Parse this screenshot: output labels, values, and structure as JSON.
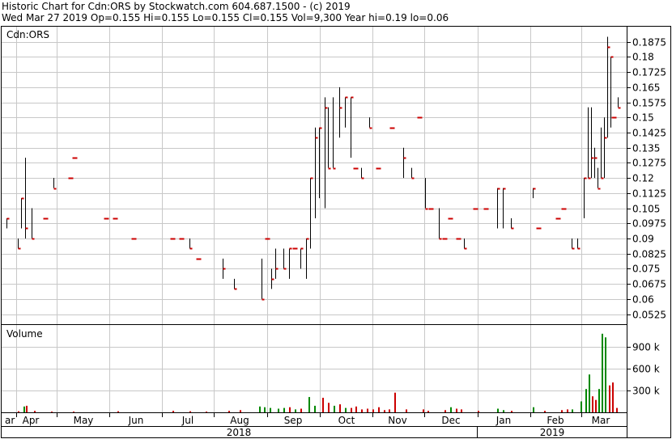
{
  "header": {
    "line1": "Historic Chart for Cdn:ORS by Stockwatch.com 604.687.1500 - (c) 2019",
    "line2": "Wed Mar 27 2019   Op=0.155  Hi=0.155  Lo=0.155  Cl=0.155  Vol=9,300   Year hi=0.19  lo=0.06"
  },
  "colors": {
    "up": "#000000",
    "down": "#cc0000",
    "vol_up": "#008800",
    "vol_down": "#cc0000",
    "grid": "#c8c8c8"
  },
  "chart_data": [
    {
      "type": "ohlc",
      "title": "Cdn:ORS",
      "ylim": [
        0.0475,
        0.195
      ],
      "y_ticks": [
        0.0525,
        0.06,
        0.0675,
        0.075,
        0.0825,
        0.09,
        0.0975,
        0.105,
        0.1125,
        0.12,
        0.1275,
        0.135,
        0.1425,
        0.15,
        0.1575,
        0.165,
        0.1725,
        0.18,
        0.1875
      ],
      "y_tick_labels": [
        "0.0525",
        "0.06",
        "0.0675",
        "0.075",
        "0.0825",
        "0.09",
        "0.0975",
        "0.105",
        "0.1125",
        "0.12",
        "0.1275",
        "0.135",
        "0.1425",
        "0.15",
        "0.1575",
        "0.165",
        "0.1725",
        "0.18",
        "0.1875"
      ],
      "x_labels": [
        "ar",
        "Apr",
        "May",
        "Jun",
        "Jul",
        "Aug",
        "Sep",
        "Oct",
        "Nov",
        "Dec",
        "Jan",
        "Feb",
        "Mar"
      ],
      "year_labels": [
        "2018",
        "2019"
      ],
      "grid": true,
      "bars": [
        [
          0,
          0.095,
          0.1,
          0.095,
          0.1,
          "u"
        ],
        [
          2.1,
          0.09,
          0.09,
          0.085,
          0.085,
          "d"
        ],
        [
          2.7,
          0.105,
          0.11,
          0.095,
          0.11,
          "u"
        ],
        [
          3.4,
          0.095,
          0.13,
          0.09,
          0.095,
          "d"
        ],
        [
          4.5,
          0.095,
          0.105,
          0.09,
          0.09,
          "d"
        ],
        [
          7,
          0.1,
          0.1,
          0.1,
          0.1,
          "d"
        ],
        [
          8.5,
          0.115,
          0.12,
          0.115,
          0.115,
          "d"
        ],
        [
          11.5,
          0.12,
          0.12,
          0.12,
          0.12,
          "d"
        ],
        [
          12.3,
          0.13,
          0.13,
          0.13,
          0.13,
          "d"
        ],
        [
          18,
          0.1,
          0.1,
          0.1,
          0.1,
          "d"
        ],
        [
          19.5,
          0.1,
          0.1,
          0.1,
          0.1,
          "d"
        ],
        [
          23,
          0.09,
          0.09,
          0.09,
          0.09,
          "d"
        ],
        [
          30,
          0.09,
          0.09,
          0.09,
          0.09,
          "d"
        ],
        [
          31.5,
          0.09,
          0.09,
          0.09,
          0.09,
          "d"
        ],
        [
          33,
          0.085,
          0.09,
          0.085,
          0.085,
          "d"
        ],
        [
          34.6,
          0.08,
          0.08,
          0.08,
          0.08,
          "d"
        ],
        [
          39,
          0.075,
          0.08,
          0.07,
          0.075,
          "d"
        ],
        [
          41,
          0.065,
          0.07,
          0.065,
          0.065,
          "d"
        ],
        [
          46,
          0.06,
          0.08,
          0.06,
          0.06,
          "d"
        ],
        [
          47,
          0.09,
          0.09,
          0.09,
          0.09,
          "d"
        ],
        [
          47.7,
          0.07,
          0.075,
          0.065,
          0.07,
          "u"
        ],
        [
          48.5,
          0.075,
          0.085,
          0.07,
          0.075,
          "d"
        ],
        [
          50,
          0.075,
          0.085,
          0.075,
          0.075,
          "d"
        ],
        [
          51,
          0.085,
          0.085,
          0.07,
          0.085,
          "u"
        ],
        [
          52,
          0.085,
          0.085,
          0.085,
          0.085,
          "d"
        ],
        [
          53,
          0.075,
          0.085,
          0.075,
          0.085,
          "u"
        ],
        [
          54,
          0.085,
          0.09,
          0.07,
          0.09,
          "u"
        ],
        [
          54.7,
          0.115,
          0.12,
          0.085,
          0.12,
          "u"
        ],
        [
          55.6,
          0.135,
          0.145,
          0.1,
          0.14,
          "u"
        ],
        [
          56.4,
          0.14,
          0.145,
          0.11,
          0.145,
          "u"
        ],
        [
          57.4,
          0.115,
          0.16,
          0.105,
          0.155,
          "u"
        ],
        [
          58,
          0.155,
          0.155,
          0.125,
          0.125,
          "d"
        ],
        [
          58.8,
          0.125,
          0.16,
          0.125,
          0.125,
          "d"
        ],
        [
          60,
          0.14,
          0.165,
          0.14,
          0.155,
          "d"
        ],
        [
          61,
          0.16,
          0.16,
          0.145,
          0.16,
          "d"
        ],
        [
          62,
          0.16,
          0.16,
          0.13,
          0.16,
          "d"
        ],
        [
          63,
          0.125,
          0.125,
          0.125,
          0.125,
          "d"
        ],
        [
          64,
          0.125,
          0.125,
          0.12,
          0.12,
          "d"
        ],
        [
          65.5,
          0.145,
          0.15,
          0.145,
          0.145,
          "d"
        ],
        [
          67,
          0.125,
          0.125,
          0.125,
          0.125,
          "d"
        ],
        [
          69.5,
          0.145,
          0.145,
          0.145,
          0.145,
          "d"
        ],
        [
          71.5,
          0.135,
          0.135,
          0.12,
          0.13,
          "d"
        ],
        [
          73,
          0.125,
          0.125,
          0.12,
          0.12,
          "d"
        ],
        [
          74.5,
          0.15,
          0.15,
          0.15,
          0.15,
          "d"
        ],
        [
          75.5,
          0.115,
          0.12,
          0.105,
          0.105,
          "d"
        ],
        [
          76.5,
          0.105,
          0.105,
          0.105,
          0.105,
          "d"
        ],
        [
          78,
          0.105,
          0.105,
          0.09,
          0.09,
          "d"
        ],
        [
          79,
          0.09,
          0.09,
          0.09,
          0.09,
          "d"
        ],
        [
          80,
          0.1,
          0.1,
          0.1,
          0.1,
          "d"
        ],
        [
          81.5,
          0.09,
          0.09,
          0.09,
          0.09,
          "d"
        ],
        [
          82.5,
          0.09,
          0.09,
          0.085,
          0.085,
          "d"
        ],
        [
          84.5,
          0.105,
          0.105,
          0.105,
          0.105,
          "d"
        ],
        [
          86.5,
          0.105,
          0.105,
          0.105,
          0.105,
          "d"
        ],
        [
          88.5,
          0.115,
          0.115,
          0.095,
          0.115,
          "u"
        ],
        [
          89.5,
          0.115,
          0.115,
          0.095,
          0.115,
          "u"
        ],
        [
          91,
          0.1,
          0.1,
          0.095,
          0.095,
          "d"
        ],
        [
          95,
          0.115,
          0.115,
          0.11,
          0.115,
          "u"
        ],
        [
          96,
          0.095,
          0.095,
          0.095,
          0.095,
          "d"
        ],
        [
          99.5,
          0.1,
          0.1,
          0.1,
          0.1,
          "d"
        ],
        [
          100.5,
          0.105,
          0.105,
          0.105,
          0.105,
          "d"
        ],
        [
          102,
          0.09,
          0.09,
          0.085,
          0.085,
          "d"
        ],
        [
          103,
          0.085,
          0.09,
          0.085,
          0.085,
          "d"
        ],
        [
          104.2,
          0.1,
          0.12,
          0.1,
          0.12,
          "u"
        ],
        [
          104.8,
          0.12,
          0.155,
          0.12,
          0.12,
          "d"
        ],
        [
          105.4,
          0.125,
          0.155,
          0.12,
          0.13,
          "u"
        ],
        [
          106,
          0.13,
          0.135,
          0.12,
          0.13,
          "d"
        ],
        [
          106.6,
          0.12,
          0.125,
          0.115,
          0.115,
          "d"
        ],
        [
          107.2,
          0.125,
          0.145,
          0.12,
          0.12,
          "d"
        ],
        [
          107.8,
          0.12,
          0.15,
          0.12,
          0.14,
          "u"
        ],
        [
          108.4,
          0.14,
          0.19,
          0.14,
          0.185,
          "u"
        ],
        [
          109,
          0.18,
          0.18,
          0.145,
          0.18,
          "u"
        ],
        [
          109.6,
          0.15,
          0.15,
          0.15,
          0.15,
          "d"
        ],
        [
          110.2,
          0.155,
          0.16,
          0.155,
          0.155,
          "d"
        ]
      ]
    },
    {
      "type": "bar",
      "title": "Volume",
      "ylim": [
        0,
        1200000
      ],
      "y_ticks": [
        300000,
        600000,
        900000
      ],
      "y_tick_labels": [
        "300 k",
        "600 k",
        "900 k"
      ],
      "bars": [
        [
          2,
          15000,
          "d"
        ],
        [
          3,
          80000,
          "g"
        ],
        [
          3.5,
          90000,
          "d"
        ],
        [
          5,
          20000,
          "d"
        ],
        [
          8,
          10000,
          "d"
        ],
        [
          12,
          10000,
          "d"
        ],
        [
          20,
          15000,
          "d"
        ],
        [
          30,
          20000,
          "d"
        ],
        [
          33,
          15000,
          "d"
        ],
        [
          36,
          10000,
          "d"
        ],
        [
          40,
          20000,
          "d"
        ],
        [
          42,
          30000,
          "d"
        ],
        [
          45.5,
          80000,
          "g"
        ],
        [
          46.5,
          70000,
          "g"
        ],
        [
          47.5,
          60000,
          "g"
        ],
        [
          49,
          50000,
          "g"
        ],
        [
          50,
          60000,
          "g"
        ],
        [
          51,
          70000,
          "d"
        ],
        [
          52,
          40000,
          "g"
        ],
        [
          53,
          50000,
          "d"
        ],
        [
          54.5,
          210000,
          "g"
        ],
        [
          55.5,
          90000,
          "g"
        ],
        [
          57,
          200000,
          "d"
        ],
        [
          58,
          130000,
          "d"
        ],
        [
          59,
          90000,
          "g"
        ],
        [
          60,
          110000,
          "d"
        ],
        [
          61,
          60000,
          "g"
        ],
        [
          62,
          60000,
          "d"
        ],
        [
          63,
          80000,
          "d"
        ],
        [
          64,
          40000,
          "d"
        ],
        [
          65,
          50000,
          "d"
        ],
        [
          66,
          40000,
          "d"
        ],
        [
          67,
          70000,
          "d"
        ],
        [
          68,
          30000,
          "d"
        ],
        [
          69,
          40000,
          "d"
        ],
        [
          70,
          270000,
          "d"
        ],
        [
          72,
          40000,
          "d"
        ],
        [
          75,
          40000,
          "d"
        ],
        [
          76,
          20000,
          "d"
        ],
        [
          79,
          30000,
          "d"
        ],
        [
          80,
          70000,
          "g"
        ],
        [
          81,
          50000,
          "d"
        ],
        [
          82,
          40000,
          "d"
        ],
        [
          85,
          20000,
          "d"
        ],
        [
          88.5,
          50000,
          "g"
        ],
        [
          89.5,
          30000,
          "g"
        ],
        [
          91,
          20000,
          "d"
        ],
        [
          95,
          70000,
          "g"
        ],
        [
          97,
          20000,
          "d"
        ],
        [
          100,
          30000,
          "d"
        ],
        [
          101,
          40000,
          "d"
        ],
        [
          102,
          40000,
          "g"
        ],
        [
          103.6,
          150000,
          "g"
        ],
        [
          104.4,
          320000,
          "g"
        ],
        [
          105,
          520000,
          "g"
        ],
        [
          105.6,
          220000,
          "d"
        ],
        [
          106.2,
          170000,
          "d"
        ],
        [
          106.8,
          320000,
          "g"
        ],
        [
          107.4,
          1080000,
          "g"
        ],
        [
          108,
          1030000,
          "g"
        ],
        [
          108.6,
          370000,
          "d"
        ],
        [
          109.2,
          410000,
          "d"
        ],
        [
          110,
          60000,
          "d"
        ]
      ]
    }
  ]
}
